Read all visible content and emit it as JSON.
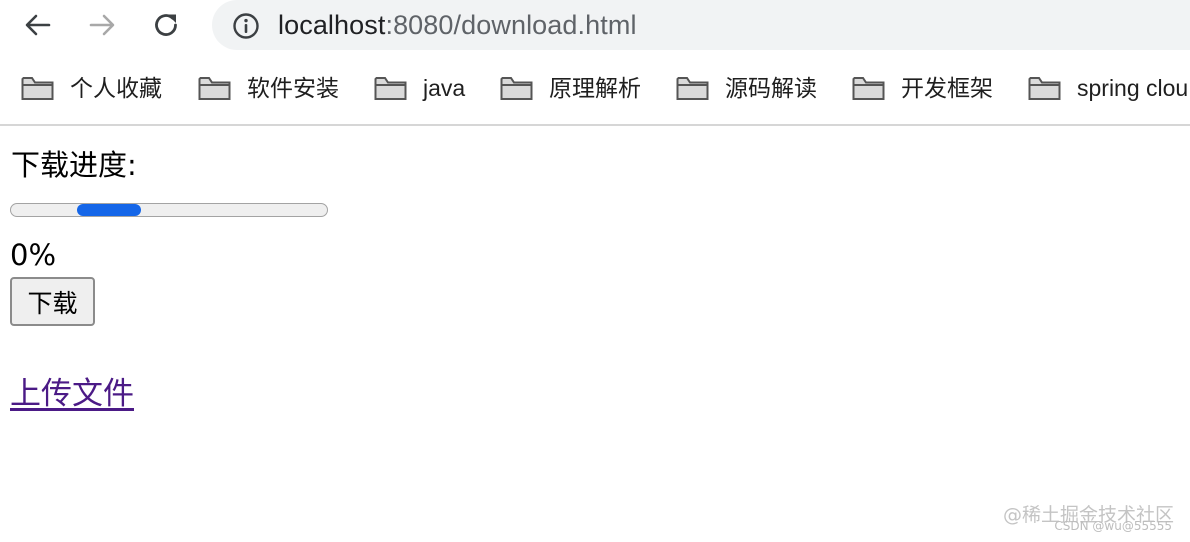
{
  "browser": {
    "url_host": "localhost",
    "url_rest": ":8080/download.html",
    "icons": {
      "back": "arrow-left-icon",
      "forward": "arrow-right-icon",
      "reload": "reload-icon",
      "site_info": "info-icon",
      "bookmark": "folder-icon"
    }
  },
  "bookmarks": [
    {
      "label": "个人收藏"
    },
    {
      "label": "软件安装"
    },
    {
      "label": "java"
    },
    {
      "label": "原理解析"
    },
    {
      "label": "源码解读"
    },
    {
      "label": "开发框架"
    },
    {
      "label": "spring clou"
    }
  ],
  "page": {
    "title": "下载进度:",
    "progress_percent_text": "0%",
    "download_button": "下载",
    "upload_link": "上传文件"
  },
  "watermark": {
    "main": "@稀土掘金技术社区",
    "sub": "CSDN @wu@55555"
  },
  "colors": {
    "progress_fill": "#1566e8",
    "link_visited": "#4b1a86",
    "omnibox_bg": "#f1f3f4"
  }
}
